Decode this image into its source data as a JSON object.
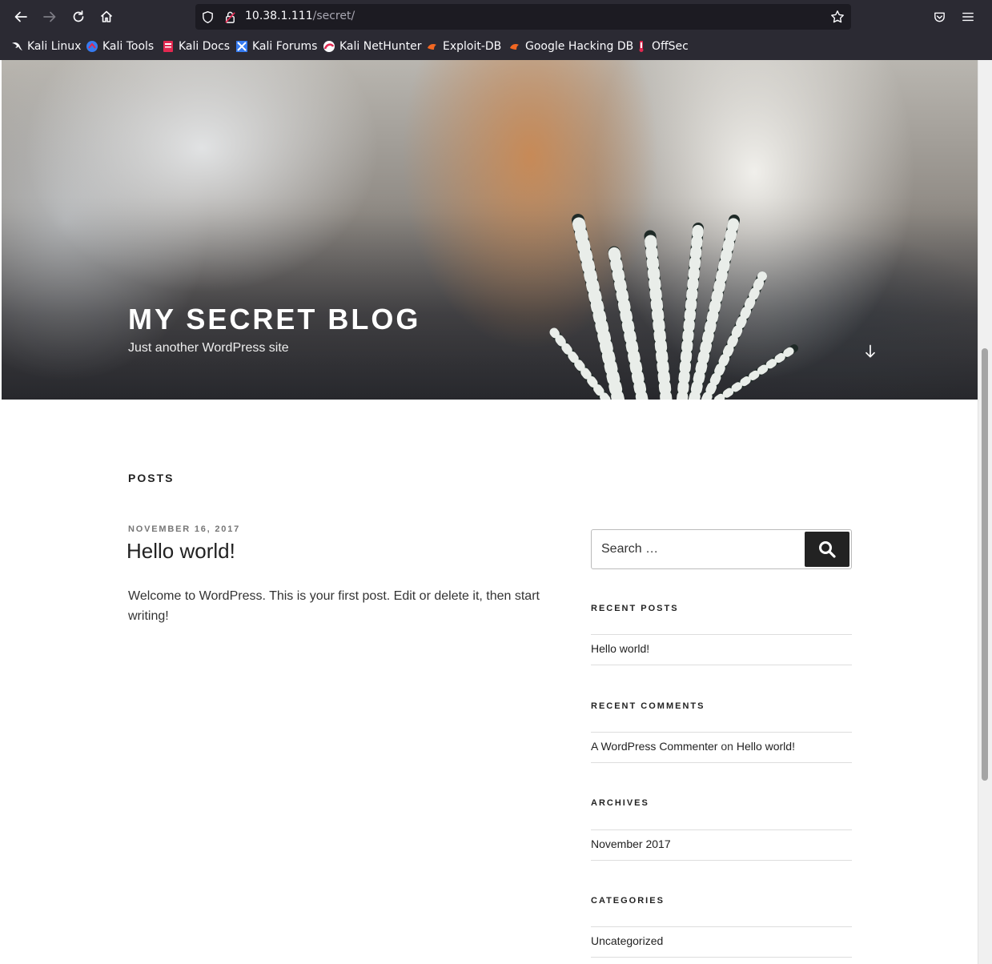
{
  "browser": {
    "url_host": "10.38.1.111",
    "url_path": "/secret/",
    "bookmarks": [
      {
        "label": "Kali Linux",
        "icon": "kali-dragon-icon"
      },
      {
        "label": "Kali Tools",
        "icon": "kali-tools-icon"
      },
      {
        "label": "Kali Docs",
        "icon": "kali-docs-icon"
      },
      {
        "label": "Kali Forums",
        "icon": "kali-forums-icon"
      },
      {
        "label": "Kali NetHunter",
        "icon": "kali-nethunter-icon"
      },
      {
        "label": "Exploit-DB",
        "icon": "exploit-db-icon"
      },
      {
        "label": "Google Hacking DB",
        "icon": "ghdb-icon"
      },
      {
        "label": "OffSec",
        "icon": "offsec-icon"
      }
    ]
  },
  "site": {
    "title": "MY SECRET BLOG",
    "description": "Just another WordPress site"
  },
  "main": {
    "heading": "POSTS",
    "post": {
      "date": "NOVEMBER 16, 2017",
      "title": "Hello world!",
      "body": "Welcome to WordPress. This is your first post. Edit or delete it, then start writing!"
    }
  },
  "sidebar": {
    "search_placeholder": "Search …",
    "recent_posts": {
      "title": "RECENT POSTS",
      "item": "Hello world!"
    },
    "recent_comments": {
      "title": "RECENT COMMENTS",
      "author": "A WordPress Commenter",
      "on": "on",
      "post": "Hello world!"
    },
    "archives": {
      "title": "ARCHIVES",
      "item": "November 2017"
    },
    "categories": {
      "title": "CATEGORIES",
      "item": "Uncategorized"
    }
  },
  "colors": {
    "chrome_bg": "#2b2a33",
    "urlbar_bg": "#1c1b22",
    "accent_dark": "#222222"
  }
}
